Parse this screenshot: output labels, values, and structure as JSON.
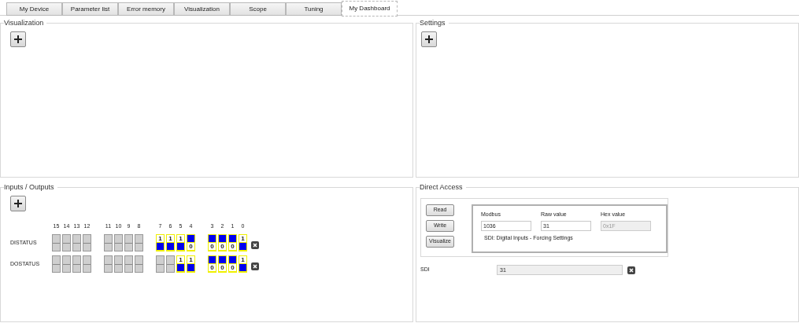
{
  "tabs": [
    {
      "label": "My Device",
      "selected": false
    },
    {
      "label": "Parameter list",
      "selected": false
    },
    {
      "label": "Error memory",
      "selected": false
    },
    {
      "label": "Visualization",
      "selected": false
    },
    {
      "label": "Scope",
      "selected": false
    },
    {
      "label": "Tuning",
      "selected": false
    },
    {
      "label": "My Dashboard",
      "selected": true
    }
  ],
  "visualization": {
    "title": "Visualization"
  },
  "settings": {
    "title": "Settings"
  },
  "io": {
    "title": "Inputs / Outputs",
    "bit_labels": [
      [
        "15",
        "14",
        "13",
        "12"
      ],
      [
        "11",
        "10",
        "9",
        "8"
      ],
      [
        "7",
        "6",
        "5",
        "4"
      ],
      [
        "3",
        "2",
        "1",
        "0"
      ]
    ],
    "rows": [
      {
        "label": "DISTATUS",
        "groups": [
          [
            {
              "kind": "off"
            },
            {
              "kind": "off"
            },
            {
              "kind": "off"
            },
            {
              "kind": "off"
            }
          ],
          [
            {
              "kind": "off"
            },
            {
              "kind": "off"
            },
            {
              "kind": "off"
            },
            {
              "kind": "off"
            }
          ],
          [
            {
              "kind": "high",
              "text": "1"
            },
            {
              "kind": "high",
              "text": "1"
            },
            {
              "kind": "high",
              "text": "1"
            },
            {
              "kind": "low",
              "text": "0"
            }
          ],
          [
            {
              "kind": "low",
              "text": "0"
            },
            {
              "kind": "low",
              "text": "0"
            },
            {
              "kind": "low",
              "text": "0"
            },
            {
              "kind": "high",
              "text": "1"
            }
          ]
        ]
      },
      {
        "label": "DOSTATUS",
        "groups": [
          [
            {
              "kind": "off"
            },
            {
              "kind": "off"
            },
            {
              "kind": "off"
            },
            {
              "kind": "off"
            }
          ],
          [
            {
              "kind": "off"
            },
            {
              "kind": "off"
            },
            {
              "kind": "off"
            },
            {
              "kind": "off"
            }
          ],
          [
            {
              "kind": "off"
            },
            {
              "kind": "off"
            },
            {
              "kind": "high",
              "text": "1"
            },
            {
              "kind": "high",
              "text": "1"
            }
          ],
          [
            {
              "kind": "low",
              "text": "0"
            },
            {
              "kind": "low",
              "text": "0"
            },
            {
              "kind": "low",
              "text": "0"
            },
            {
              "kind": "high",
              "text": "1"
            }
          ]
        ]
      }
    ]
  },
  "direct_access": {
    "title": "Direct Access",
    "buttons": [
      "Read",
      "Write",
      "Visualize"
    ],
    "fields": [
      {
        "label": "Modbus",
        "value": "1036",
        "disabled": false
      },
      {
        "label": "Raw value",
        "value": "31",
        "disabled": false
      },
      {
        "label": "Hex value",
        "value": "0x1F",
        "disabled": true
      }
    ],
    "description": "SDI: Digital Inputs - Forcing Settings",
    "sdi": {
      "label": "SDI",
      "value": "31"
    }
  }
}
